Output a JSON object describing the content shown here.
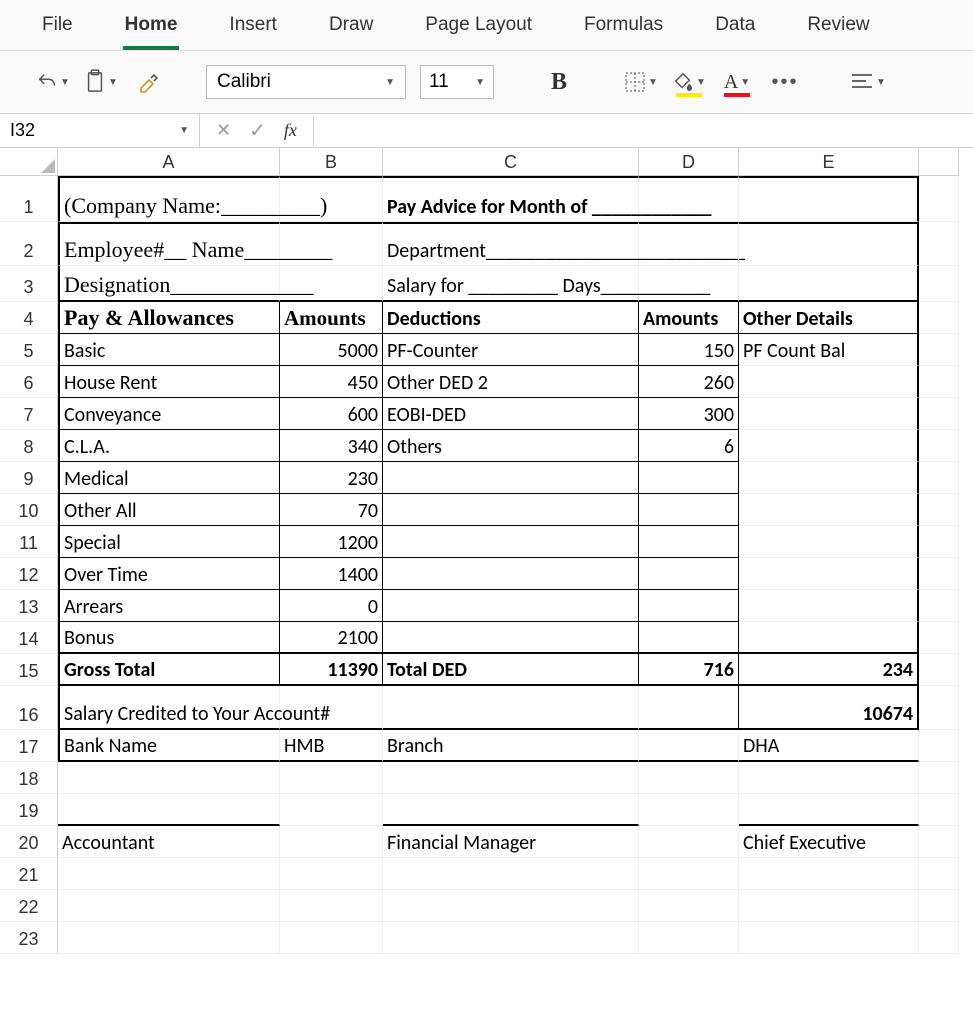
{
  "ribbon": {
    "tabs": [
      "File",
      "Home",
      "Insert",
      "Draw",
      "Page Layout",
      "Formulas",
      "Data",
      "Review"
    ],
    "font": "Calibri",
    "size": "11"
  },
  "nameBox": "I32",
  "cols": [
    "A",
    "B",
    "C",
    "D",
    "E"
  ],
  "rows": [
    "1",
    "2",
    "3",
    "4",
    "5",
    "6",
    "7",
    "8",
    "9",
    "10",
    "11",
    "12",
    "13",
    "14",
    "15",
    "16",
    "17",
    "18",
    "19",
    "20",
    "21",
    "22",
    "23"
  ],
  "sheet": {
    "r1": {
      "A": "(Company Name:_________)",
      "C": "Pay Advice for Month of ____________"
    },
    "r2": {
      "A": "Employee#__   Name________",
      "C": "Department__________________________"
    },
    "r3": {
      "A": "Designation_____________",
      "C": "Salary for _________ Days___________"
    },
    "r4": {
      "A": "Pay & Allowances",
      "B": "Amounts",
      "C": "Deductions",
      "D": "Amounts",
      "E": "Other Details"
    },
    "r5": {
      "A": "Basic",
      "B": "5000",
      "C": "PF-Counter",
      "D": "150",
      "E": "PF Count Bal"
    },
    "r6": {
      "A": "House Rent",
      "B": "450",
      "C": "Other DED 2",
      "D": "260"
    },
    "r7": {
      "A": "Conveyance",
      "B": "600",
      "C": "EOBI-DED",
      "D": "300"
    },
    "r8": {
      "A": "C.L.A.",
      "B": "340",
      "C": "Others",
      "D": "6"
    },
    "r9": {
      "A": "Medical",
      "B": "230"
    },
    "r10": {
      "A": "Other All",
      "B": "70"
    },
    "r11": {
      "A": "Special",
      "B": "1200"
    },
    "r12": {
      "A": "Over Time",
      "B": "1400"
    },
    "r13": {
      "A": "Arrears",
      "B": "0"
    },
    "r14": {
      "A": "Bonus",
      "B": "2100"
    },
    "r15": {
      "A": "Gross Total",
      "B": "11390",
      "C": "Total DED",
      "D": "716",
      "E": "234"
    },
    "r16": {
      "A": "Salary Credited to Your Account#",
      "E": "10674"
    },
    "r17": {
      "A": "Bank Name",
      "B": "HMB",
      "C": "Branch",
      "E": "DHA"
    },
    "r20": {
      "A": "Accountant",
      "C": "Financial Manager",
      "E": "Chief Executive"
    }
  }
}
